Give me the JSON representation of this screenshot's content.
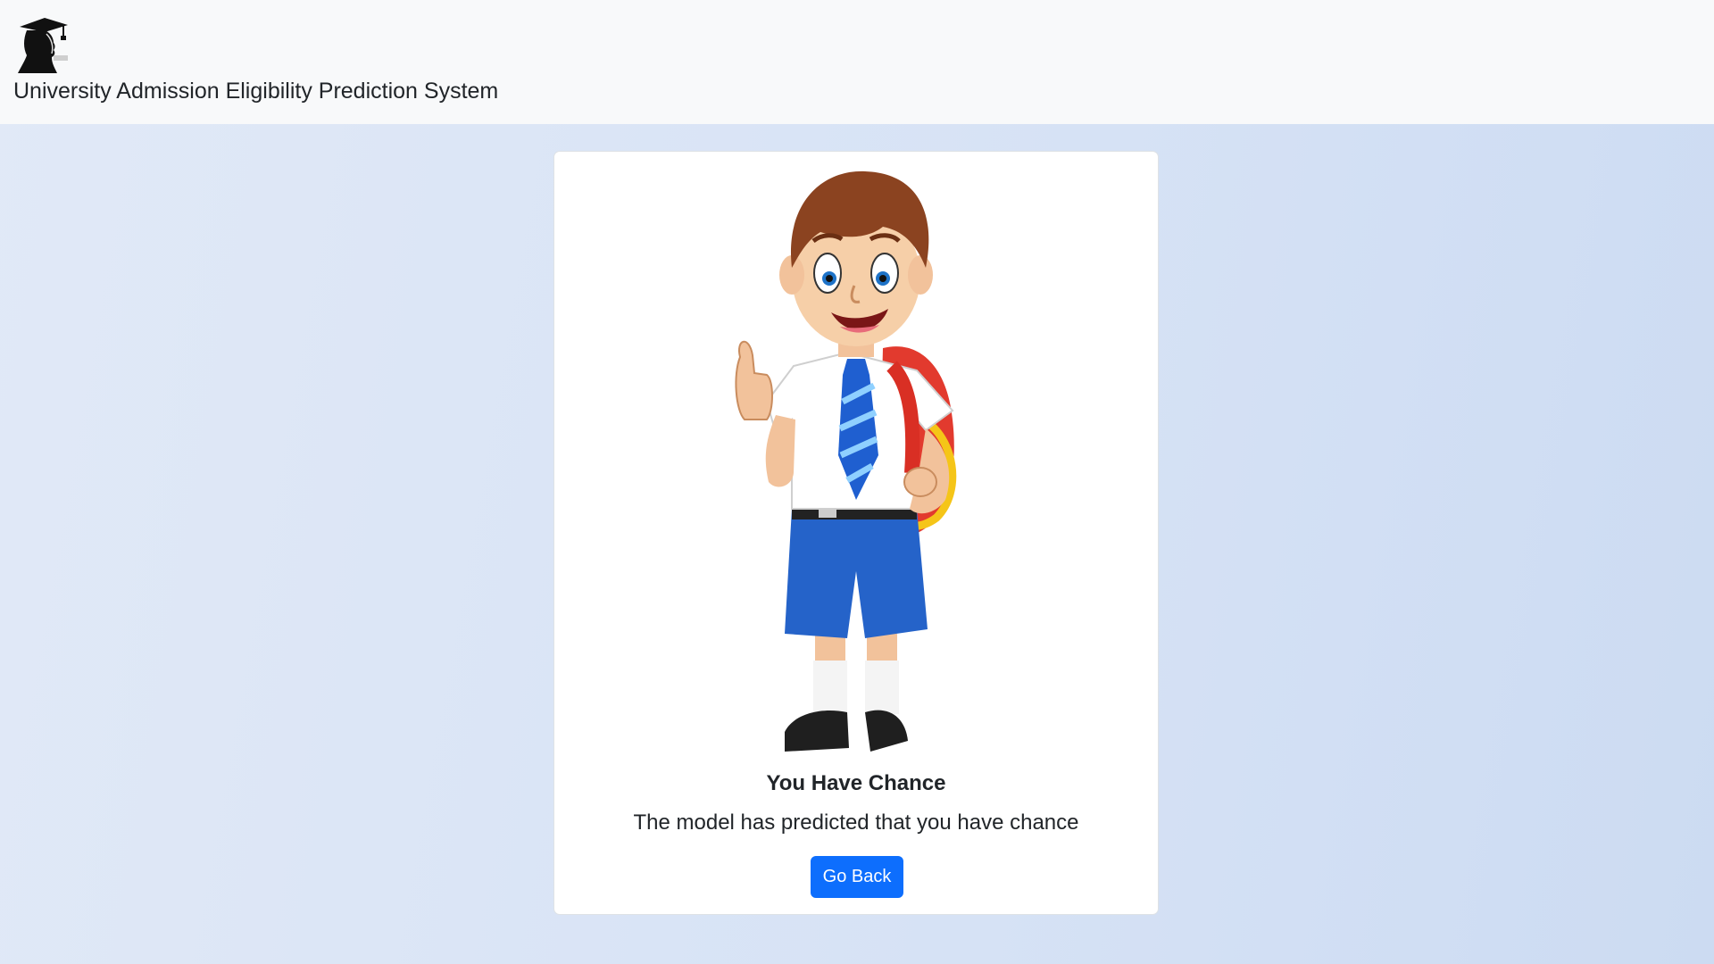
{
  "navbar": {
    "logo_icon": "graduate-silhouette-icon",
    "title": "University Admission Eligibility Prediction System"
  },
  "result": {
    "illustration_icon": "student-thumbs-up-illustration",
    "title": "You Have Chance",
    "message": "The model has predicted that you have chance",
    "button_label": "Go Back"
  },
  "colors": {
    "navbar_bg": "#f8f9fa",
    "page_bg": "#d9e4f6",
    "button_bg": "#0d6efd",
    "text": "#212529"
  }
}
